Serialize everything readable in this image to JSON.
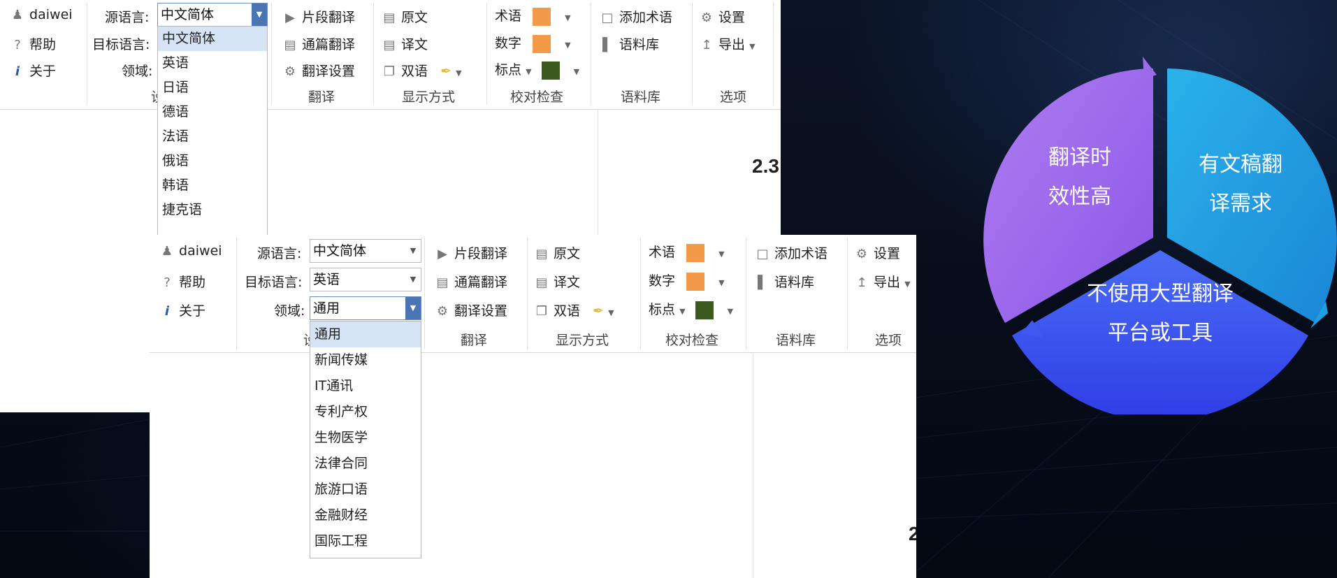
{
  "win1": {
    "user": "daiwei",
    "help": "帮助",
    "about": "关于",
    "src_label": "源语言:",
    "tgt_label": "目标语言:",
    "domain_label": "领域:",
    "src_value": "中文简体",
    "lang_options": [
      "中文简体",
      "英语",
      "日语",
      "德语",
      "法语",
      "俄语",
      "韩语",
      "捷克语"
    ],
    "partial_label": "设",
    "seg_translate": "片段翻译",
    "full_translate": "通篇翻译",
    "translate_settings": "翻译设置",
    "group_translate": "翻译",
    "source_text": "原文",
    "target_text": "译文",
    "bilingual": "双语",
    "group_display": "显示方式",
    "term": "术语",
    "number": "数字",
    "punct": "标点",
    "group_proof": "校对检查",
    "add_term": "添加术语",
    "corpus": "语料库",
    "group_corpus": "语料库",
    "settings": "设置",
    "export": "导出",
    "group_options": "选项",
    "doc_number": "2.3"
  },
  "win2": {
    "user": "daiwei",
    "help": "帮助",
    "about": "关于",
    "src_label": "源语言:",
    "tgt_label": "目标语言:",
    "domain_label": "领域:",
    "src_value": "中文简体",
    "tgt_value": "英语",
    "domain_value": "通用",
    "domain_options": [
      "通用",
      "新闻传媒",
      "IT通讯",
      "专利产权",
      "生物医学",
      "法律合同",
      "旅游口语",
      "金融财经",
      "国际工程"
    ],
    "partial_label": "设",
    "seg_translate": "片段翻译",
    "full_translate": "通篇翻译",
    "translate_settings": "翻译设置",
    "group_translate": "翻译",
    "source_text": "原文",
    "target_text": "译文",
    "bilingual": "双语",
    "group_display": "显示方式",
    "term": "术语",
    "number": "数字",
    "punct": "标点",
    "group_proof": "校对检查",
    "add_term": "添加术语",
    "corpus": "语料库",
    "group_corpus": "语料库",
    "settings": "设置",
    "export": "导出",
    "group_options": "选项",
    "doc_number": "2"
  },
  "colors": {
    "term": "#f39a4a",
    "number": "#f39a4a",
    "punct": "#3d5a1e",
    "bilingual_pen": "#e8b93a"
  },
  "diagram": {
    "segments": [
      {
        "lines": [
          "翻译时",
          "效性高"
        ],
        "color": "#9b6bea"
      },
      {
        "lines": [
          "有文稿翻",
          "译需求"
        ],
        "color": "#1f9fe0"
      },
      {
        "lines": [
          "不使用大型翻译",
          "平台或工具"
        ],
        "color": "#3e58f0"
      }
    ]
  }
}
